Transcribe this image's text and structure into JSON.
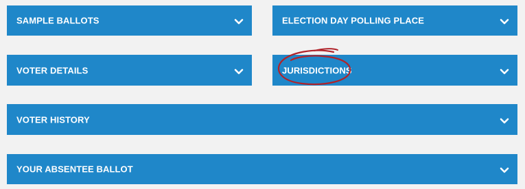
{
  "colors": {
    "background": "#f2f2f2",
    "panel": "#1f87c9",
    "text": "#ffffff",
    "annotation": "#b0232a"
  },
  "panels": [
    {
      "label": "SAMPLE BALLOTS",
      "icon": "chevron-down-icon"
    },
    {
      "label": "ELECTION DAY POLLING PLACE",
      "icon": "chevron-down-icon"
    },
    {
      "label": "VOTER DETAILS",
      "icon": "chevron-down-icon"
    },
    {
      "label": "JURISDICTIONS",
      "icon": "chevron-down-icon"
    },
    {
      "label": "VOTER HISTORY",
      "icon": "chevron-down-icon"
    },
    {
      "label": "YOUR ABSENTEE BALLOT",
      "icon": "chevron-down-icon"
    }
  ]
}
